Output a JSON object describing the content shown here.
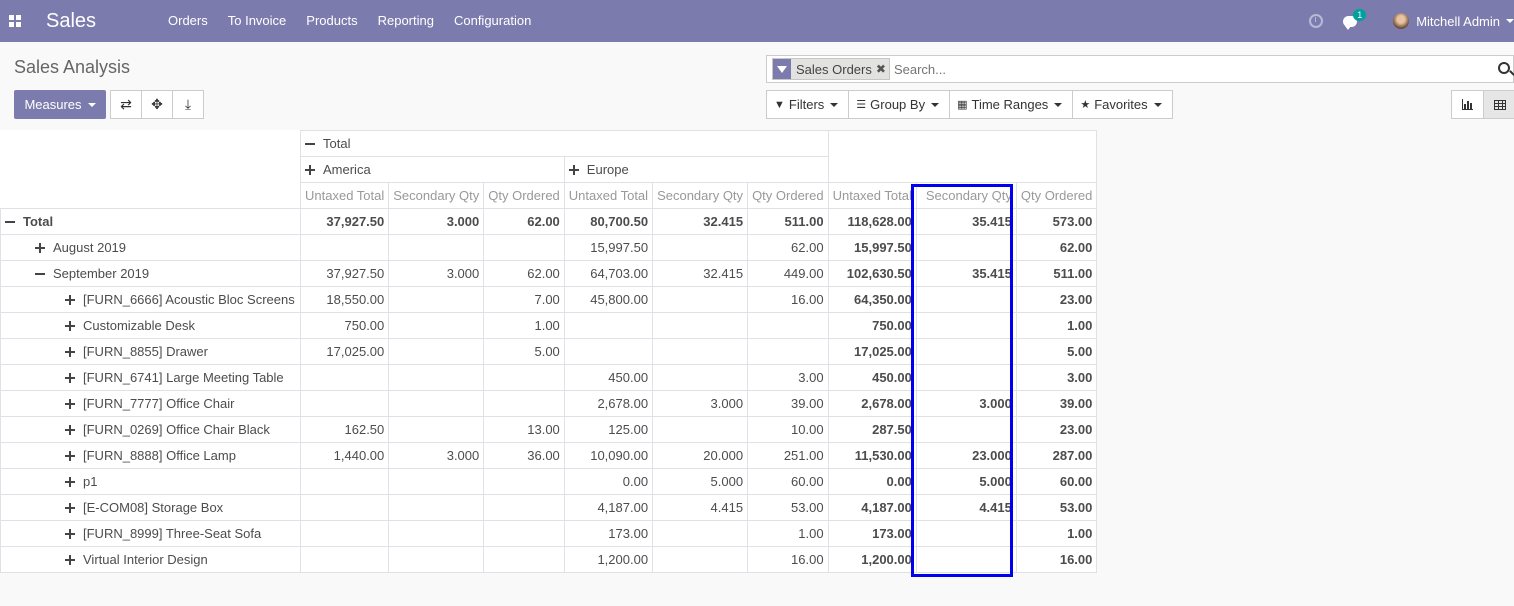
{
  "navbar": {
    "app_name": "Sales",
    "menu": [
      "Orders",
      "To Invoice",
      "Products",
      "Reporting",
      "Configuration"
    ],
    "chat_count": "1",
    "user_name": "Mitchell Admin",
    "accent_color": "#7c7bad"
  },
  "control_panel": {
    "title": "Sales Analysis",
    "measures_label": "Measures",
    "facet_label": "Sales Orders",
    "search_placeholder": "Search...",
    "filters_label": "Filters",
    "group_by_label": "Group By",
    "time_ranges_label": "Time Ranges",
    "favorites_label": "Favorites"
  },
  "pivot": {
    "col_total": "Total",
    "col_groups": [
      "America",
      "Europe"
    ],
    "measures": [
      "Untaxed Total",
      "Secondary Qty",
      "Qty Ordered"
    ],
    "rows": [
      {
        "label": "Total",
        "level": 0,
        "expanded": true,
        "cells": [
          "37,927.50",
          "3.000",
          "62.00",
          "80,700.50",
          "32.415",
          "511.00",
          "118,628.00",
          "35.415",
          "573.00"
        ]
      },
      {
        "label": "August 2019",
        "level": 1,
        "expanded": false,
        "cells": [
          "",
          "",
          "",
          "15,997.50",
          "",
          "62.00",
          "15,997.50",
          "",
          "62.00"
        ]
      },
      {
        "label": "September 2019",
        "level": 1,
        "expanded": true,
        "cells": [
          "37,927.50",
          "3.000",
          "62.00",
          "64,703.00",
          "32.415",
          "449.00",
          "102,630.50",
          "35.415",
          "511.00"
        ]
      },
      {
        "label": "[FURN_6666] Acoustic Bloc Screens",
        "level": 2,
        "expanded": false,
        "cells": [
          "18,550.00",
          "",
          "7.00",
          "45,800.00",
          "",
          "16.00",
          "64,350.00",
          "",
          "23.00"
        ]
      },
      {
        "label": "Customizable Desk",
        "level": 2,
        "expanded": false,
        "cells": [
          "750.00",
          "",
          "1.00",
          "",
          "",
          "",
          "750.00",
          "",
          "1.00"
        ]
      },
      {
        "label": "[FURN_8855] Drawer",
        "level": 2,
        "expanded": false,
        "cells": [
          "17,025.00",
          "",
          "5.00",
          "",
          "",
          "",
          "17,025.00",
          "",
          "5.00"
        ]
      },
      {
        "label": "[FURN_6741] Large Meeting Table",
        "level": 2,
        "expanded": false,
        "cells": [
          "",
          "",
          "",
          "450.00",
          "",
          "3.00",
          "450.00",
          "",
          "3.00"
        ]
      },
      {
        "label": "[FURN_7777] Office Chair",
        "level": 2,
        "expanded": false,
        "cells": [
          "",
          "",
          "",
          "2,678.00",
          "3.000",
          "39.00",
          "2,678.00",
          "3.000",
          "39.00"
        ]
      },
      {
        "label": "[FURN_0269] Office Chair Black",
        "level": 2,
        "expanded": false,
        "cells": [
          "162.50",
          "",
          "13.00",
          "125.00",
          "",
          "10.00",
          "287.50",
          "",
          "23.00"
        ]
      },
      {
        "label": "[FURN_8888] Office Lamp",
        "level": 2,
        "expanded": false,
        "cells": [
          "1,440.00",
          "3.000",
          "36.00",
          "10,090.00",
          "20.000",
          "251.00",
          "11,530.00",
          "23.000",
          "287.00"
        ]
      },
      {
        "label": "p1",
        "level": 2,
        "expanded": false,
        "cells": [
          "",
          "",
          "",
          "0.00",
          "5.000",
          "60.00",
          "0.00",
          "5.000",
          "60.00"
        ]
      },
      {
        "label": "[E-COM08] Storage Box",
        "level": 2,
        "expanded": false,
        "cells": [
          "",
          "",
          "",
          "4,187.00",
          "4.415",
          "53.00",
          "4,187.00",
          "4.415",
          "53.00"
        ]
      },
      {
        "label": "[FURN_8999] Three-Seat Sofa",
        "level": 2,
        "expanded": false,
        "cells": [
          "",
          "",
          "",
          "173.00",
          "",
          "1.00",
          "173.00",
          "",
          "1.00"
        ]
      },
      {
        "label": "Virtual Interior Design",
        "level": 2,
        "expanded": false,
        "cells": [
          "",
          "",
          "",
          "1,200.00",
          "",
          "16.00",
          "1,200.00",
          "",
          "16.00"
        ]
      }
    ]
  }
}
